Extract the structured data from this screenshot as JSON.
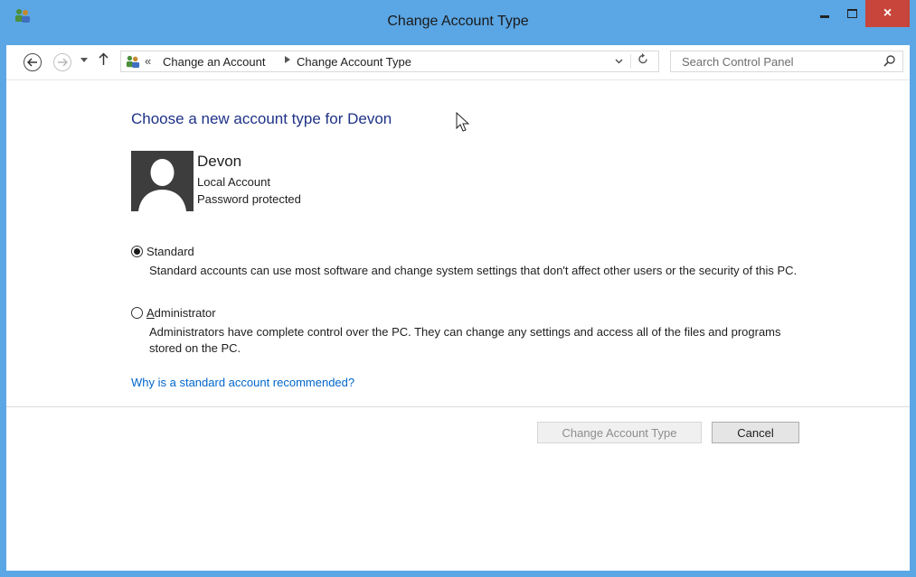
{
  "window": {
    "title": "Change Account Type",
    "close_glyph": "×"
  },
  "navigation": {
    "breadcrumb_sep": "«",
    "crumbs": [
      "Change an Account",
      "Change Account Type"
    ],
    "search_placeholder": "Search Control Panel"
  },
  "main": {
    "heading": "Choose a new account type for Devon",
    "user": {
      "name": "Devon",
      "account_type": "Local Account",
      "password_status": "Password protected"
    },
    "options": [
      {
        "label": "Standard",
        "selected": true,
        "description": "Standard accounts can use most software and change system settings that don't affect other users or the security of this PC."
      },
      {
        "label_access_key": "A",
        "label_rest": "dministrator",
        "selected": false,
        "description": "Administrators have complete control over the PC. They can change any settings and access all of the files and programs stored on the PC."
      }
    ],
    "help_link": "Why is a standard account recommended?"
  },
  "buttons": {
    "change_label": "Change Account Type",
    "cancel_label": "Cancel"
  },
  "colors": {
    "title_bar": "#5ba6e4",
    "close_button": "#c7453a",
    "heading": "#1e3287",
    "link": "#0066cc"
  }
}
